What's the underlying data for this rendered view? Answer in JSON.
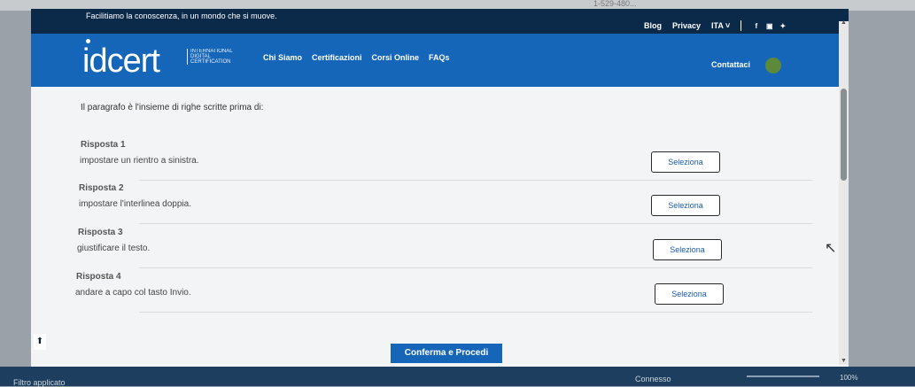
{
  "browser": {
    "text": "1-529-480..."
  },
  "topbar": {
    "tagline": "Facilitiamo la conoscenza, in un mondo che si muove.",
    "links": [
      "Blog",
      "Privacy",
      "ITA"
    ],
    "social": [
      "facebook-icon",
      "linkedin-icon",
      "twitter-icon"
    ]
  },
  "logo": {
    "name": "idcert",
    "sub": [
      "INTERNATIONAL",
      "DIGITAL",
      "CERTIFICATION"
    ]
  },
  "nav": {
    "items": [
      "Chi Siamo",
      "Certificazioni",
      "Corsi Online",
      "FAQs"
    ],
    "contact": "Contattaci"
  },
  "question": "Il paragrafo è l'insieme di righe scritte prima di:",
  "answers": [
    {
      "title": "Risposta 1",
      "text": "impostare un rientro a sinistra.",
      "button": "Seleziona"
    },
    {
      "title": "Risposta 2",
      "text": "impostare l'interlinea doppia.",
      "button": "Seleziona"
    },
    {
      "title": "Risposta 3",
      "text": "giustificare il testo.",
      "button": "Seleziona"
    },
    {
      "title": "Risposta 4",
      "text": "andare a capo col tasto Invio.",
      "button": "Seleziona"
    }
  ],
  "up_button": "⬆",
  "confirm_button": "Conferma e Procedi",
  "status": {
    "left": "Filtro applicato",
    "middle": "Connesso",
    "zoom": "100%"
  }
}
